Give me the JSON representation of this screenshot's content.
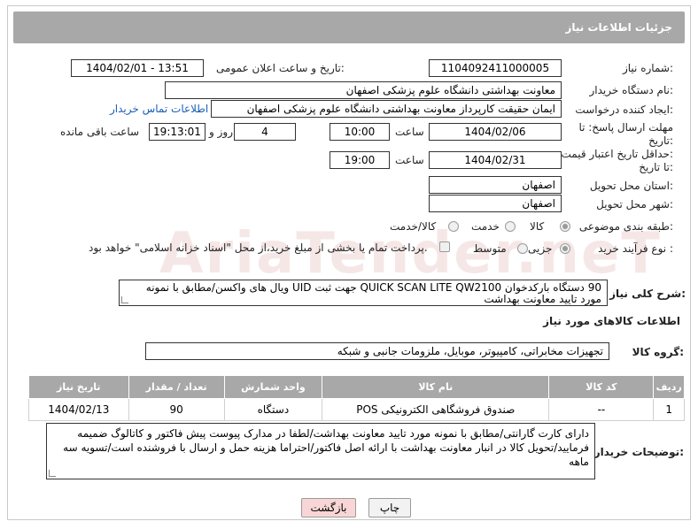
{
  "header": {
    "title": "جزئیات اطلاعات نیاز"
  },
  "fields": {
    "need_number_label": "شماره نیاز:",
    "need_number": "1104092411000005",
    "announce_label": "تاریخ و ساعت اعلان عمومی:",
    "announce_value": "1404/02/01 - 13:51",
    "buyer_org_label": "نام دستگاه خریدار:",
    "buyer_org": "معاونت بهداشتی دانشگاه علوم پزشکی اصفهان",
    "requester_label": "ایجاد کننده درخواست:",
    "requester": "ایمان حقیقت کارپرداز معاونت بهداشتی دانشگاه علوم پزشکی اصفهان",
    "contact_link": "اطلاعات تماس خریدار",
    "deadline_label_1": "مهلت ارسال پاسخ: تا",
    "deadline_label_2": "تاریخ:",
    "deadline_date": "1404/02/06",
    "time_label": "ساعت",
    "deadline_time": "10:00",
    "days_value": "4",
    "days_label": "روز و",
    "remaining_time": "19:13:01",
    "remaining_label": "ساعت باقی مانده",
    "validity_label_1": "حداقل تاریخ اعتبار قیمت:",
    "validity_label_2": "تا تاریخ:",
    "validity_date": "1404/02/31",
    "validity_time_label": "ساعت",
    "validity_time": "19:00",
    "province_label": "استان محل تحویل:",
    "province": "اصفهان",
    "city_label": "شهر محل تحویل:",
    "city": "اصفهان",
    "category_label": "طبقه بندی موضوعی:",
    "category_options": [
      "کالا",
      "خدمت",
      "کالا/خدمت"
    ],
    "process_label": "نوع فرآیند خرید :",
    "process_options": [
      "جزیی",
      "متوسط"
    ],
    "payment_note": "پرداخت تمام یا بخشی از مبلغ خرید،از محل \"اسناد خزانه اسلامی\" خواهد بود."
  },
  "description": {
    "label": "شرح کلی نیاز:",
    "text": "90 دستگاه بارکدخوان QUICK SCAN LITE QW2100 جهت ثبت UID ویال های واکسن/مطابق با نمونه مورد تایید معاونت بهداشت"
  },
  "goods_section": {
    "title": "اطلاعات کالاهای مورد نیاز",
    "group_label": "گروه کالا:",
    "group_value": "تجهیزات مخابراتی، کامپیوتر، موبایل، ملزومات جانبی و شبکه"
  },
  "table": {
    "headers": [
      "ردیف",
      "کد کالا",
      "نام کالا",
      "واحد شمارش",
      "تعداد / مقدار",
      "تاریخ نیاز"
    ],
    "rows": [
      [
        "1",
        "--",
        "صندوق فروشگاهی الکترونیکی POS",
        "دستگاه",
        "90",
        "1404/02/13"
      ]
    ]
  },
  "buyer_notes": {
    "label": "توضیحات خریدار:",
    "text": "دارای کارت گارانتی/مطابق با نمونه مورد تایید معاونت بهداشت/لطفا در مدارک پیوست پیش فاکتور و کاتالوگ ضمیمه فرمایید/تحویل کالا در انبار معاونت بهداشت با ارائه اصل فاکتور/احتراما هزینه حمل و ارسال با فروشنده است/تسویه سه ماهه"
  },
  "buttons": {
    "print": "چاپ",
    "back": "بازگشت"
  },
  "watermark": "AriaTender.neT"
}
